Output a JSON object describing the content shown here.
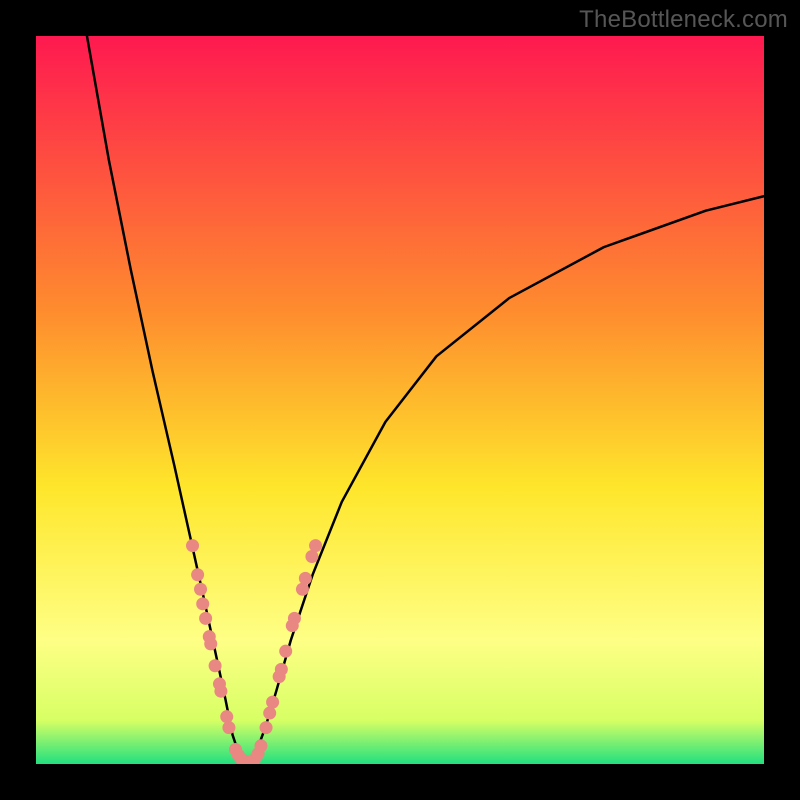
{
  "watermark": "TheBottleneck.com",
  "colors": {
    "grad_top": "#fe1950",
    "grad_mid1": "#fe8d2e",
    "grad_mid2": "#fee62b",
    "grad_mid3": "#feff85",
    "grad_mid4": "#d7ff64",
    "grad_bottom": "#22e07f",
    "curve": "#000000",
    "marker": "#e98783",
    "frame": "#000000"
  },
  "chart_data": {
    "type": "line",
    "title": "",
    "xlabel": "",
    "ylabel": "",
    "x_range": [
      0,
      100
    ],
    "y_range": [
      0,
      100
    ],
    "optimal_x": 27,
    "series": [
      {
        "name": "left-branch",
        "x": [
          7,
          10,
          13,
          16,
          19,
          21,
          23,
          24.5,
          26,
          27,
          28,
          29
        ],
        "y": [
          100,
          83,
          68,
          54,
          41,
          32,
          23,
          16,
          9,
          4,
          1,
          0
        ]
      },
      {
        "name": "right-branch",
        "x": [
          29,
          30,
          31.5,
          33,
          35,
          38,
          42,
          48,
          55,
          65,
          78,
          92,
          100
        ],
        "y": [
          0,
          1,
          5,
          10,
          17,
          26,
          36,
          47,
          56,
          64,
          71,
          76,
          78
        ]
      }
    ],
    "markers": {
      "name": "highlighted-points",
      "points": [
        {
          "x": 21.5,
          "y": 30
        },
        {
          "x": 22.2,
          "y": 26
        },
        {
          "x": 22.6,
          "y": 24
        },
        {
          "x": 22.9,
          "y": 22
        },
        {
          "x": 23.3,
          "y": 20
        },
        {
          "x": 23.8,
          "y": 17.5
        },
        {
          "x": 24.0,
          "y": 16.5
        },
        {
          "x": 24.6,
          "y": 13.5
        },
        {
          "x": 25.2,
          "y": 11
        },
        {
          "x": 25.4,
          "y": 10
        },
        {
          "x": 26.2,
          "y": 6.5
        },
        {
          "x": 26.5,
          "y": 5
        },
        {
          "x": 27.4,
          "y": 2
        },
        {
          "x": 27.8,
          "y": 1.2
        },
        {
          "x": 28.3,
          "y": 0.6
        },
        {
          "x": 28.8,
          "y": 0.3
        },
        {
          "x": 29.2,
          "y": 0.2
        },
        {
          "x": 29.6,
          "y": 0.3
        },
        {
          "x": 30.0,
          "y": 0.6
        },
        {
          "x": 30.5,
          "y": 1.4
        },
        {
          "x": 30.9,
          "y": 2.5
        },
        {
          "x": 31.6,
          "y": 5
        },
        {
          "x": 32.1,
          "y": 7
        },
        {
          "x": 32.5,
          "y": 8.5
        },
        {
          "x": 33.4,
          "y": 12
        },
        {
          "x": 33.7,
          "y": 13
        },
        {
          "x": 34.3,
          "y": 15.5
        },
        {
          "x": 35.2,
          "y": 19
        },
        {
          "x": 35.5,
          "y": 20
        },
        {
          "x": 36.6,
          "y": 24
        },
        {
          "x": 37.0,
          "y": 25.5
        },
        {
          "x": 37.9,
          "y": 28.5
        },
        {
          "x": 38.4,
          "y": 30
        }
      ]
    }
  }
}
